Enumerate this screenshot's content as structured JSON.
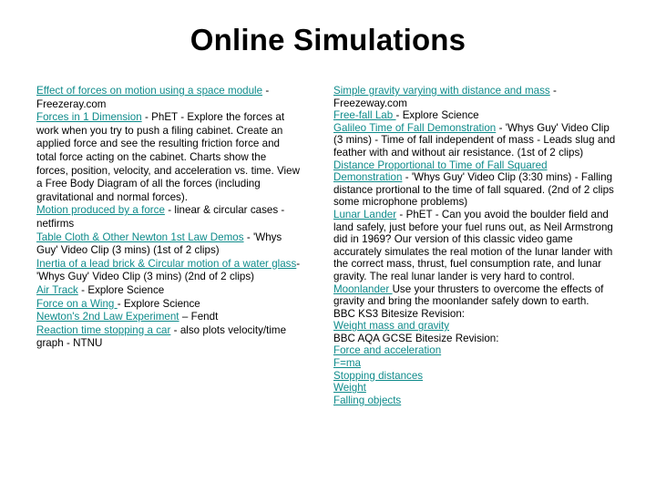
{
  "slide": {
    "title": "Online Simulations",
    "background_color": "#ffffff",
    "link_color": "#0e8b8b",
    "text_color": "#000000"
  },
  "left_column": {
    "items": [
      {
        "link": "Effect of forces on motion using a space module",
        "text": " - Freezeray.com"
      },
      {
        "link": "Forces in 1 Dimension",
        "text": " - PhET - Explore the forces at work when you try to push a filing cabinet. Create an applied force and see the resulting friction force and total force acting on the cabinet. Charts show the forces, position, velocity, and acceleration vs. time. View a Free Body Diagram of all the forces (including gravitational and normal forces)."
      },
      {
        "link": "Motion produced by a force",
        "text": " - linear & circular cases - netfirms"
      },
      {
        "link": "Table Cloth & Other Newton 1st Law Demos",
        "text": " - 'Whys Guy' Video Clip (3 mins) (1st of 2 clips)"
      },
      {
        "link": "Inertia of a lead brick & Circular motion of a water glass",
        "text": "- 'Whys Guy' Video Clip (3 mins) (2nd of 2 clips)"
      },
      {
        "link": "Air Track",
        "text": " - Explore Science"
      },
      {
        "link": "Force on a Wing ",
        "text": "- Explore Science"
      },
      {
        "link": "Newton's 2nd Law Experiment",
        "text": " – Fendt"
      },
      {
        "link": "Reaction time stopping a car",
        "text": " - also plots velocity/time graph - NTNU"
      }
    ]
  },
  "right_column": {
    "items": [
      {
        "link": "Simple gravity varying with distance and mass",
        "text": " - Freezeway.com"
      },
      {
        "link": "Free-fall Lab ",
        "text": "- Explore Science"
      },
      {
        "link": "Galileo Time of Fall Demonstration",
        "text": " - 'Whys Guy' Video Clip (3 mins) - Time of fall independent of mass - Leads slug and feather with and without air resistance. (1st of 2 clips)"
      },
      {
        "link": "Distance Proportional to Time of Fall Squared Demonstration",
        "text": " - 'Whys Guy' Video Clip (3:30 mins) - Falling distance prortional to the time of fall squared. (2nd of 2 clips some microphone problems)"
      },
      {
        "link": "Lunar Lander",
        "text": " - PhET - Can you avoid the boulder field and land safely, just before your fuel runs out, as Neil Armstrong did in 1969? Our version of this classic video game accurately simulates the real motion of the lunar lander with the correct mass, thrust, fuel consumption rate, and lunar gravity. The real lunar lander is very hard to control."
      },
      {
        "link": "Moonlander ",
        "text": "Use your thrusters to overcome the effects of gravity and bring the moonlander safely down to earth."
      },
      {
        "link": "",
        "text": "BBC KS3 Bitesize Revision:"
      },
      {
        "link": "Weight mass and gravity",
        "text": ""
      },
      {
        "link": "",
        "text": "BBC AQA GCSE Bitesize Revision:"
      },
      {
        "link": "Force and acceleration",
        "text": ""
      },
      {
        "link": "F=ma",
        "text": ""
      },
      {
        "link": "Stopping distances",
        "text": ""
      },
      {
        "link": "Weight",
        "text": ""
      },
      {
        "link": "Falling objects",
        "text": ""
      }
    ]
  }
}
